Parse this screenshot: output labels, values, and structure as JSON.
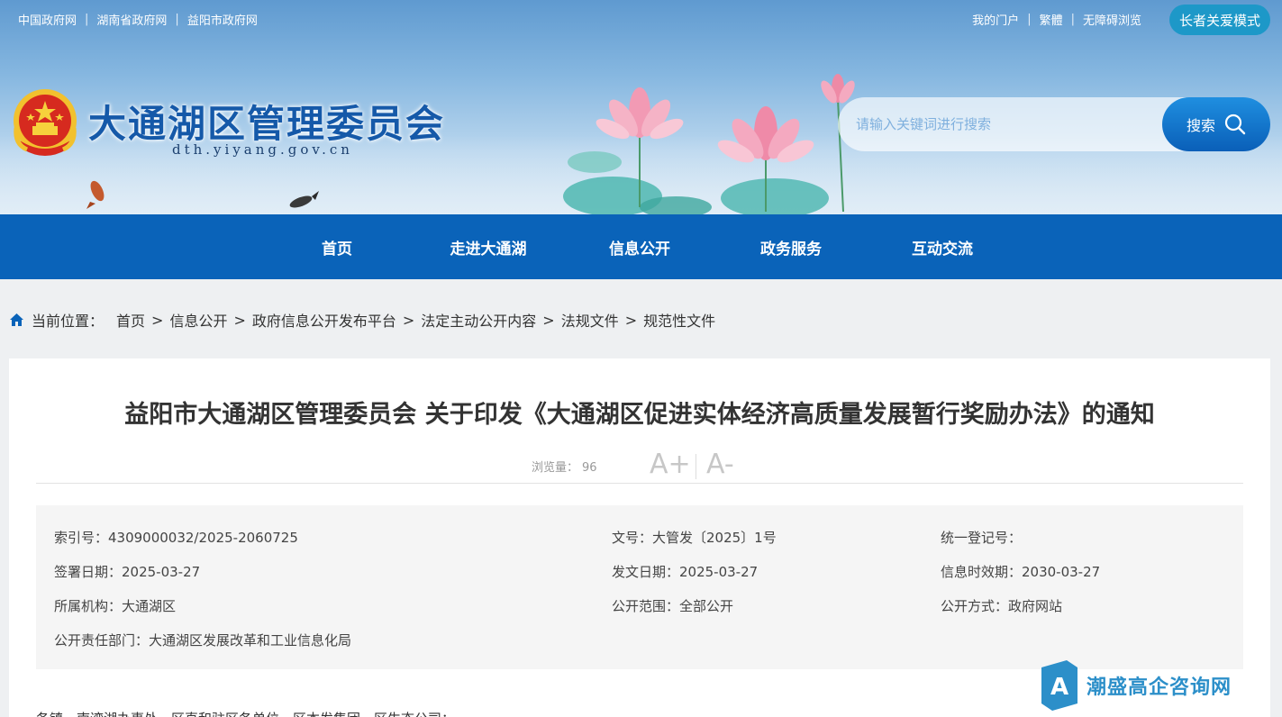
{
  "topbar": {
    "left_links": [
      "中国政府网",
      "湖南省政府网",
      "益阳市政府网"
    ],
    "right_links": [
      "我的门户",
      "繁體",
      "无障碍浏览"
    ],
    "elder_mode": "长者关爱模式"
  },
  "header": {
    "site_title": "大通湖区管理委员会",
    "site_domain": "dth.yiyang.gov.cn"
  },
  "search": {
    "placeholder": "请输入关键词进行搜索",
    "button_label": "搜索"
  },
  "nav": {
    "items": [
      "首页",
      "走进大通湖",
      "信息公开",
      "政务服务",
      "互动交流"
    ]
  },
  "breadcrumb": {
    "label": "当前位置：",
    "items": [
      "首页",
      "信息公开",
      "政府信息公开发布平台",
      "法定主动公开内容",
      "法规文件",
      "规范性文件"
    ]
  },
  "article": {
    "title": "益阳市大通湖区管理委员会 关于印发《大通湖区促进实体经济高质量发展暂行奖励办法》的通知",
    "views_label": "浏览量：",
    "views": "96",
    "font_increase": "A+",
    "font_decrease": "A-",
    "body_start": "各镇，南湾湖办事处，区直和驻区各单位，区本发集团，区生态公司："
  },
  "info": {
    "index_no": "索引号：4309000032/2025-2060725",
    "doc_no": "文号：大管发〔2025〕1号",
    "reg_no": "统一登记号：",
    "sign_date": "签署日期：2025-03-27",
    "issue_date": "发文日期：2025-03-27",
    "valid_date": "信息时效期：2030-03-27",
    "org": "所属机构：大通湖区",
    "scope": "公开范围：全部公开",
    "method": "公开方式：政府网站",
    "dept": "公开责任部门：大通湖区发展改革和工业信息化局"
  },
  "watermark": {
    "text": "潮盛高企咨询网",
    "letter": "A"
  }
}
